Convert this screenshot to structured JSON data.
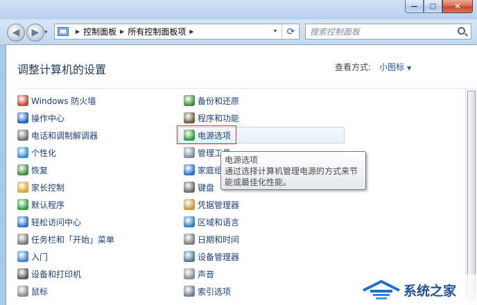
{
  "window": {
    "controls": {
      "minimize": "—",
      "maximize": "□",
      "close": "✕"
    }
  },
  "nav": {
    "back_icon": "◀",
    "forward_icon": "▶",
    "dropdown_icon": "▾",
    "breadcrumbs": [
      "控制面板",
      "所有控制面板项"
    ],
    "refresh_icon": "⟳",
    "search_placeholder": "搜索控制面板"
  },
  "header": {
    "title": "调整计算机的设置",
    "view_by_label": "查看方式:",
    "view_by_value": "小图标",
    "view_arrow": "▼"
  },
  "items_left": [
    {
      "label": "Windows 防火墙",
      "color": "#c2442b"
    },
    {
      "label": "操作中心",
      "color": "#1f5fc0"
    },
    {
      "label": "电话和调制解调器",
      "color": "#6b6b6b"
    },
    {
      "label": "个性化",
      "color": "#2f8bd6"
    },
    {
      "label": "恢复",
      "color": "#3b8a3b"
    },
    {
      "label": "家长控制",
      "color": "#e0a02a"
    },
    {
      "label": "默认程序",
      "color": "#2b9b3a"
    },
    {
      "label": "轻松访问中心",
      "color": "#2a6bc8"
    },
    {
      "label": "任务栏和「开始」菜单",
      "color": "#777777"
    },
    {
      "label": "入门",
      "color": "#3d7fd0"
    },
    {
      "label": "设备和打印机",
      "color": "#555555"
    },
    {
      "label": "鼠标",
      "color": "#888888"
    }
  ],
  "items_right": [
    {
      "label": "备份和还原",
      "color": "#3b8a3b"
    },
    {
      "label": "程序和功能",
      "color": "#6a5a3a"
    },
    {
      "label": "电源选项",
      "color": "#2f9a2f"
    },
    {
      "label": "管理工具",
      "color": "#7a8aa0"
    },
    {
      "label": "家庭组",
      "color": "#2b6bd0"
    },
    {
      "label": "键盘",
      "color": "#666666"
    },
    {
      "label": "凭据管理器",
      "color": "#c9962a"
    },
    {
      "label": "区域和语言",
      "color": "#2a7fc0"
    },
    {
      "label": "日期和时间",
      "color": "#7a7a7a"
    },
    {
      "label": "设备管理器",
      "color": "#4a7a9a"
    },
    {
      "label": "声音",
      "color": "#8a8a8a"
    },
    {
      "label": "索引选项",
      "color": "#6a7a8a"
    }
  ],
  "tooltip": {
    "title": "电源选项",
    "body": "通过选择计算机管理电源的方式来节能或最佳化性能。"
  },
  "watermark": {
    "text": "系统之家"
  }
}
